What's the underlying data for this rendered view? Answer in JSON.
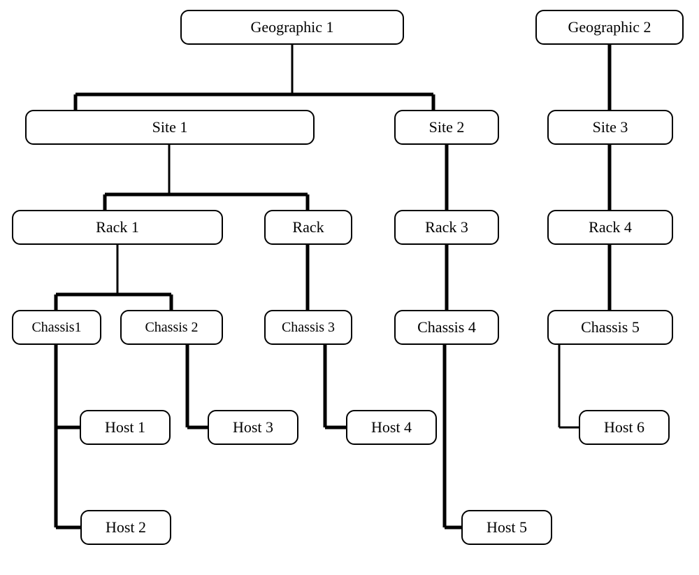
{
  "chart_data": {
    "type": "tree",
    "title": "",
    "roots": [
      {
        "name": "Geographic 1",
        "children": [
          {
            "name": "Site 1",
            "children": [
              {
                "name": "Rack 1",
                "children": [
                  {
                    "name": "Chassis1",
                    "children": [
                      {
                        "name": "Host 1"
                      },
                      {
                        "name": "Host 2"
                      }
                    ]
                  },
                  {
                    "name": "Chassis 2",
                    "children": [
                      {
                        "name": "Host 3"
                      }
                    ]
                  }
                ]
              },
              {
                "name": "Rack",
                "children": [
                  {
                    "name": "Chassis 3",
                    "children": [
                      {
                        "name": "Host 4"
                      }
                    ]
                  }
                ]
              }
            ]
          },
          {
            "name": "Site 2",
            "children": [
              {
                "name": "Rack 3",
                "children": [
                  {
                    "name": "Chassis 4",
                    "children": [
                      {
                        "name": "Host 5"
                      }
                    ]
                  }
                ]
              }
            ]
          }
        ]
      },
      {
        "name": "Geographic 2",
        "children": [
          {
            "name": "Site 3",
            "children": [
              {
                "name": "Rack 4",
                "children": [
                  {
                    "name": "Chassis 5",
                    "children": [
                      {
                        "name": "Host 6"
                      }
                    ]
                  }
                ]
              }
            ]
          }
        ]
      }
    ]
  },
  "labels": {
    "geo1": "Geographic 1",
    "geo2": "Geographic 2",
    "site1": "Site 1",
    "site2": "Site 2",
    "site3": "Site 3",
    "rack1": "Rack 1",
    "rack2": "Rack",
    "rack3": "Rack 3",
    "rack4": "Rack 4",
    "ch1": "Chassis1",
    "ch2": "Chassis 2",
    "ch3": "Chassis 3",
    "ch4": "Chassis 4",
    "ch5": "Chassis 5",
    "h1": "Host 1",
    "h2": "Host 2",
    "h3": "Host 3",
    "h4": "Host 4",
    "h5": "Host 5",
    "h6": "Host 6"
  }
}
